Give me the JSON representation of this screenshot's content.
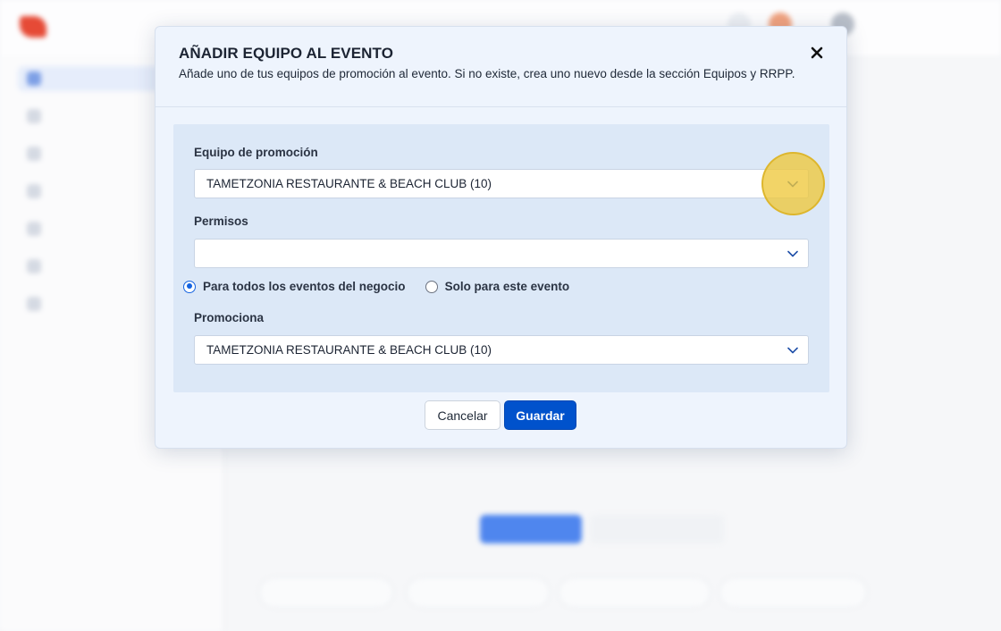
{
  "modal": {
    "title": "AÑADIR EQUIPO AL EVENTO",
    "subtitle": "Añade uno de tus equipos de promoción al evento. Si no existe, crea uno nuevo desde la sección Equipos y RRPP.",
    "fields": {
      "team": {
        "label": "Equipo de promoción",
        "value": "TAMETZONIA RESTAURANTE & BEACH CLUB (10)"
      },
      "permissions": {
        "label": "Permisos",
        "value": ""
      },
      "scope": {
        "options": [
          {
            "label": "Para todos los eventos del negocio",
            "selected": true
          },
          {
            "label": "Solo para este evento",
            "selected": false
          }
        ]
      },
      "promotes": {
        "label": "Promociona",
        "value": "TAMETZONIA RESTAURANTE & BEACH CLUB (10)"
      }
    },
    "buttons": {
      "cancel": "Cancelar",
      "save": "Guardar"
    }
  },
  "colors": {
    "primary": "#0052cc",
    "highlight": "#eec83c",
    "modal_bg": "#eef4fd",
    "panel_bg": "#dce8f7"
  },
  "icons": {
    "close": "close-icon",
    "dropdown": "chevron-down-icon"
  }
}
